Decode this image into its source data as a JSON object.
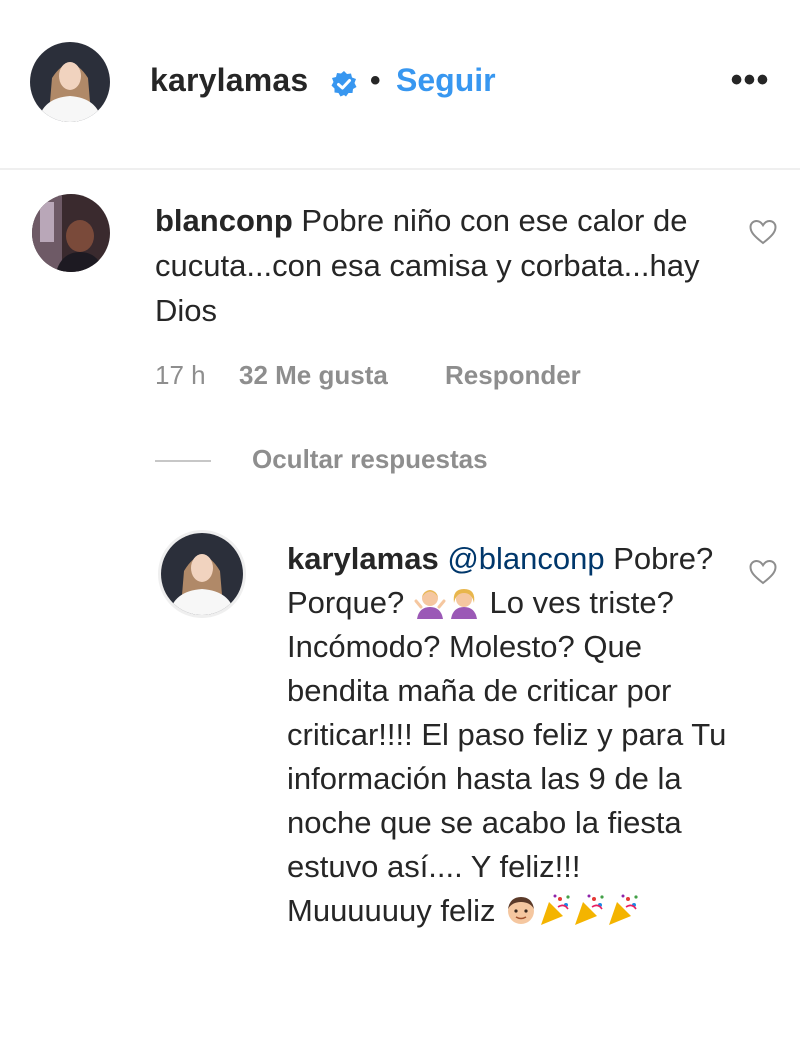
{
  "header": {
    "username": "karylamas",
    "separator": "•",
    "follow_label": "Seguir",
    "more_label": "•••"
  },
  "comment": {
    "username": "blanconp",
    "text": "Pobre niño con ese calor de cucuta...con esa camisa y corbata...hay Dios",
    "time": "17 h",
    "likes": "32 Me gusta",
    "reply_label": "Responder"
  },
  "replies_toggle": "Ocultar respuestas",
  "reply": {
    "username": "karylamas",
    "mention": "@blanconp",
    "text_part1": "Pobre? Porque?",
    "text_part2": "Lo ves triste? Incómodo? Molesto? Que bendita maña de criticar por criticar!!!! El paso feliz y para Tu información hasta las 9 de la noche que se acabo la fiesta estuvo así.... Y feliz!!! Muuuuuuy feliz",
    "emojis_after_part1": [
      "person-shrugging-icon",
      "person-shrugging-icon"
    ],
    "emojis_after_part2": [
      "boy-face-icon",
      "party-popper-icon",
      "party-popper-icon",
      "party-popper-icon"
    ]
  },
  "colors": {
    "link": "#3897f0",
    "verified": "#3897f0",
    "muted": "#8e8e8e",
    "text": "#262626"
  }
}
